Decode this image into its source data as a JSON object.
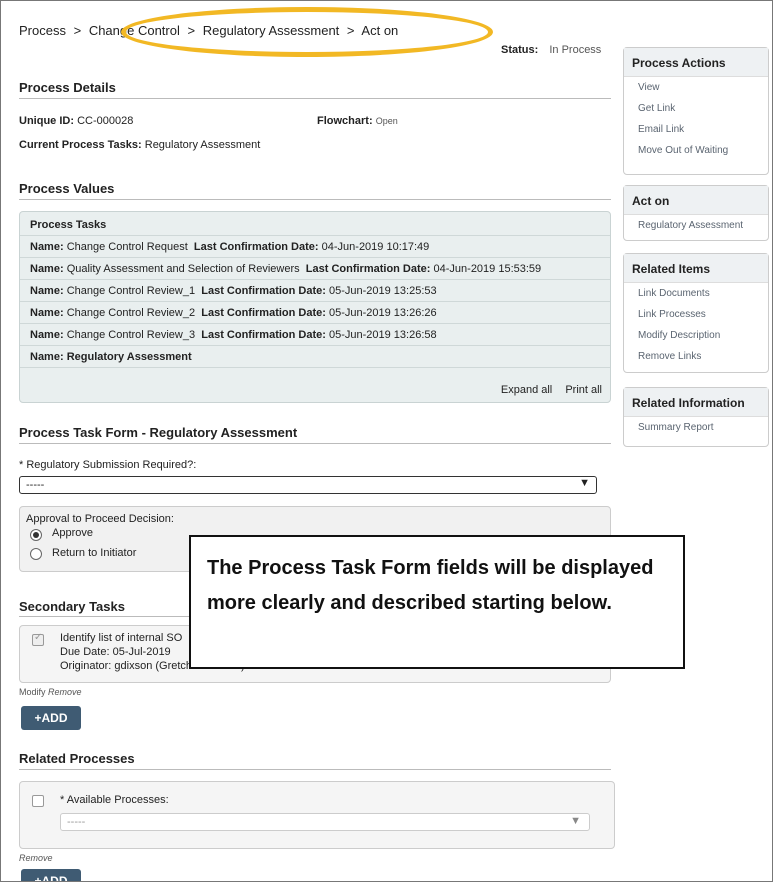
{
  "breadcrumb": {
    "items": [
      "Process",
      ">",
      "Change Control",
      ">",
      "Regulatory Assessment",
      ">",
      "Act on"
    ]
  },
  "status": {
    "label": "Status:",
    "value": "In Process"
  },
  "process_details": {
    "title": "Process Details",
    "unique_id_label": "Unique ID:",
    "unique_id_value": "CC-000028",
    "flowchart_label": "Flowchart:",
    "flowchart_value": "Open",
    "current_tasks_label": "Current Process Tasks:",
    "current_tasks_value": "Regulatory Assessment"
  },
  "process_values": {
    "title": "Process Values",
    "panel_title": "Process Tasks",
    "name_label": "Name:",
    "date_label": "Last Confirmation Date:",
    "tasks": [
      {
        "name": "Change Control Request",
        "date": "04-Jun-2019 10:17:49"
      },
      {
        "name": "Quality Assessment and Selection of Reviewers",
        "date": "04-Jun-2019 15:53:59"
      },
      {
        "name": "Change Control Review_1",
        "date": "05-Jun-2019 13:25:53"
      },
      {
        "name": "Change Control Review_2",
        "date": "05-Jun-2019 13:26:26"
      },
      {
        "name": "Change Control Review_3",
        "date": "05-Jun-2019 13:26:58"
      },
      {
        "name": "Regulatory Assessment",
        "date": ""
      }
    ],
    "expand_all": "Expand all",
    "print_all": "Print all"
  },
  "task_form": {
    "title": "Process Task Form - Regulatory Assessment",
    "submission_label": "* Regulatory Submission Required?:",
    "submission_value": "-----",
    "decision_label": "Approval to Proceed Decision:",
    "options": [
      "Approve",
      "Return to Initiator"
    ],
    "selected": "Approve"
  },
  "secondary_tasks": {
    "title": "Secondary Tasks",
    "item_title": "Identify list of internal SO",
    "item_due": "Due Date: 05-Jul-2019",
    "item_originator": "Originator: gdixson (Gretchen Dixson)",
    "modify": "Modify",
    "remove": "Remove",
    "add_label": "+ADD"
  },
  "related_processes": {
    "title": "Related Processes",
    "available_label": "* Available Processes:",
    "available_value": "-----",
    "remove": "Remove",
    "add_label": "+ADD"
  },
  "callout": {
    "text": "The Process Task Form fields will be displayed more clearly and described starting below."
  },
  "sidebar": {
    "process_actions": {
      "title": "Process Actions",
      "items": [
        "View",
        "Get Link",
        "Email Link",
        "Move Out of Waiting"
      ]
    },
    "act_on": {
      "title": "Act on",
      "items": [
        "Regulatory Assessment"
      ]
    },
    "related_items": {
      "title": "Related Items",
      "items": [
        "Link Documents",
        "Link Processes",
        "Modify Description",
        "Remove Links"
      ]
    },
    "related_information": {
      "title": "Related Information",
      "items": [
        "Summary Report"
      ]
    }
  },
  "colors": {
    "highlight": "#f2b824",
    "button": "#3f5b73",
    "panel": "#e9efef"
  }
}
